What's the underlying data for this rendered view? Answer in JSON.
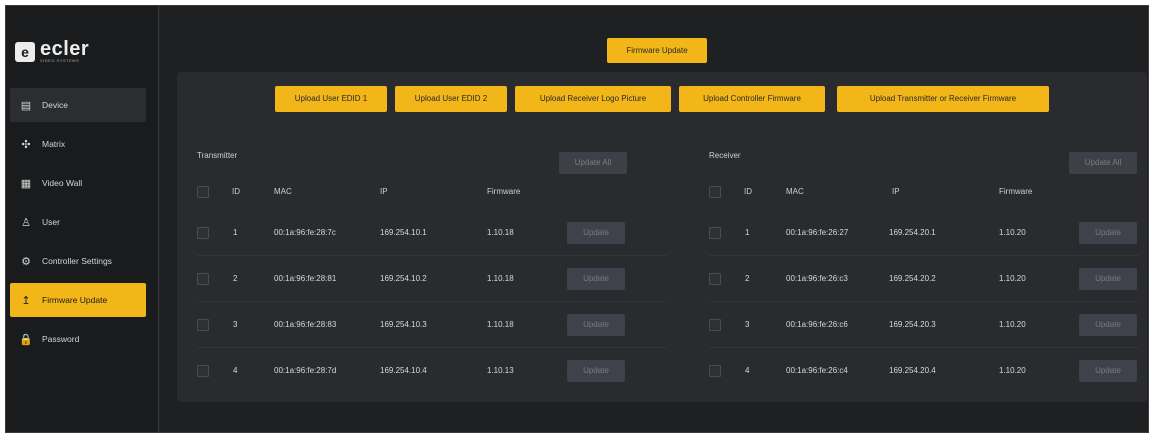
{
  "app": {
    "logo_letter": "e",
    "logo_text": "ecler",
    "logo_subtext": "VIDEO SYSTEMS"
  },
  "sidebar": {
    "items": [
      {
        "label": "Device",
        "icon": "device-icon",
        "glyph": "▤"
      },
      {
        "label": "Matrix",
        "icon": "matrix-icon",
        "glyph": "✣"
      },
      {
        "label": "Video Wall",
        "icon": "video-wall-icon",
        "glyph": "▦"
      },
      {
        "label": "User",
        "icon": "user-icon",
        "glyph": "♙"
      },
      {
        "label": "Controller Settings",
        "icon": "gear-icon",
        "glyph": "⚙"
      },
      {
        "label": "Firmware Update",
        "icon": "upload-icon",
        "glyph": "↥"
      },
      {
        "label": "Password",
        "icon": "lock-icon",
        "glyph": "🔒"
      }
    ]
  },
  "header": {
    "firmware_update_label": "Firmware Update"
  },
  "uploads": {
    "user_edid_1": "Upload User EDID 1",
    "user_edid_2": "Upload User EDID 2",
    "receiver_logo": "Upload Receiver Logo Picture",
    "controller_fw": "Upload Controller Firmware",
    "tx_rx_fw": "Upload Transmitter or Receiver Firmware"
  },
  "transmitter": {
    "title": "Transmitter",
    "update_all": "Update All",
    "columns": {
      "id": "ID",
      "mac": "MAC",
      "ip": "IP",
      "firmware": "Firmware"
    },
    "rows": [
      {
        "id": "1",
        "mac": "00:1a:96:fe:28:7c",
        "ip": "169.254.10.1",
        "firmware": "1.10.18",
        "action": "Update"
      },
      {
        "id": "2",
        "mac": "00:1a:96:fe:28:81",
        "ip": "169.254.10.2",
        "firmware": "1.10.18",
        "action": "Update"
      },
      {
        "id": "3",
        "mac": "00:1a:96:fe:28:83",
        "ip": "169.254.10.3",
        "firmware": "1.10.18",
        "action": "Update"
      },
      {
        "id": "4",
        "mac": "00:1a:96:fe:28:7d",
        "ip": "169.254.10.4",
        "firmware": "1.10.13",
        "action": "Update"
      }
    ]
  },
  "receiver": {
    "title": "Receiver",
    "update_all": "Update All",
    "columns": {
      "id": "ID",
      "mac": "MAC",
      "ip": "IP",
      "firmware": "Firmware"
    },
    "rows": [
      {
        "id": "1",
        "mac": "00:1a:96:fe:26:27",
        "ip": "169.254.20.1",
        "firmware": "1.10.20",
        "action": "Update"
      },
      {
        "id": "2",
        "mac": "00:1a:96:fe:26:c3",
        "ip": "169.254.20.2",
        "firmware": "1.10.20",
        "action": "Update"
      },
      {
        "id": "3",
        "mac": "00:1a:96:fe:26:c6",
        "ip": "169.254.20.3",
        "firmware": "1.10.20",
        "action": "Update"
      },
      {
        "id": "4",
        "mac": "00:1a:96:fe:26:c4",
        "ip": "169.254.20.4",
        "firmware": "1.10.20",
        "action": "Update"
      }
    ]
  },
  "colors": {
    "accent": "#f2b619",
    "background": "#1f2022",
    "panel": "#2a2b2e",
    "disabled_button": "#3f424b"
  }
}
